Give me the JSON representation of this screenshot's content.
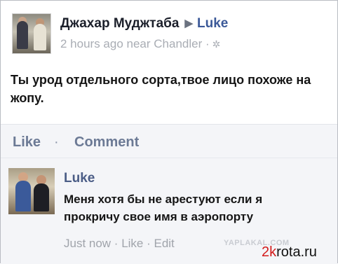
{
  "post": {
    "author": "Джахар Муджтаба",
    "target": "Luke",
    "meta": "2 hours ago near Chandler ·",
    "text": "Ты урод отдельного сорта,твое лицо похоже на жопу."
  },
  "actions": {
    "like": "Like",
    "separator": "·",
    "comment": "Comment"
  },
  "comment": {
    "author": "Luke",
    "text": "Меня хотя бы не арестуют если я прокричу свое имя в аэропорту",
    "meta": "Just now · Like · Edit"
  },
  "watermarks": {
    "yaplakal": "YAPLAKAL.COM",
    "krota_k": "2k",
    "krota_rest": "rota.ru"
  },
  "icons": {
    "arrow": "right-triangle-icon",
    "privacy": "gear-icon"
  },
  "colors": {
    "link": "#3b5998",
    "action": "#6c7a95",
    "meta": "#a9adb4"
  }
}
